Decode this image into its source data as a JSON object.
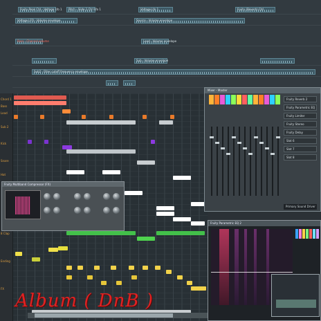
{
  "playlist": {
    "clips": [
      {
        "label": "Fruity Peak Ctrl - Voltage Lfo 1",
        "color": "normal"
      },
      {
        "label": "Pitch - Slide 1 Ctrl Lfo 1",
        "color": "normal"
      },
      {
        "label": "Voltage Lfo 1",
        "color": "normal"
      },
      {
        "label": "Fruity (Reverb) Ctrl",
        "color": "normal"
      },
      {
        "label": "Voltage LFO - Volume envelope",
        "color": "normal"
      },
      {
        "label": "Source - Volume envelope",
        "color": "normal"
      },
      {
        "label": "Bass - Channel volume",
        "color": "red"
      },
      {
        "label": "Lead - Volume envelope",
        "color": "normal"
      },
      {
        "label": "Sub - Volume envelope",
        "color": "normal"
      },
      {
        "label": "Sub2 - Filter cutoff frequency envelope",
        "color": "normal"
      }
    ]
  },
  "pianoroll": {
    "key_labels": [
      "Chord 1",
      "Bass",
      "Lead",
      "Sub 2",
      "Kick",
      "Snare",
      "Hat",
      "8 Clap",
      "Ending",
      "FX"
    ]
  },
  "mixer": {
    "title": "Mixer - Master",
    "plugins": [
      "Fruity Reverb 2",
      "Fruity Parametric EQ",
      "Fruity Limiter",
      "Fruity Stereo",
      "Fruity Delay",
      "Slot 6",
      "Slot 7",
      "Slot 8"
    ],
    "footer": "Primary Sound Driver",
    "accent_colors": [
      "#ffb43a",
      "#ff7f27",
      "#e95bd6",
      "#2fd0ff",
      "#8cff5a",
      "#ffd93a",
      "#ff5f5f",
      "#60ff9f"
    ]
  },
  "compressor": {
    "title": "Fruity Multiband Compressor (FX)"
  },
  "eq": {
    "title": "Fruity Parametric EQ 2"
  },
  "watermark": {
    "text": "Album ( DnB )"
  }
}
